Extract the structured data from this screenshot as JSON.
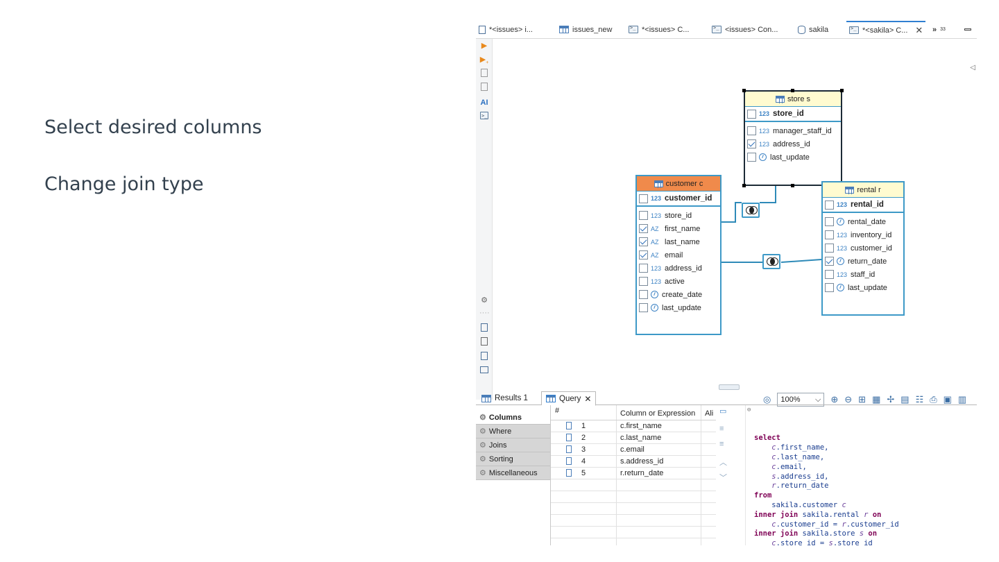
{
  "slide": {
    "bullets": [
      "Select desired columns",
      "Change join type"
    ]
  },
  "editor_tabs": [
    {
      "label": "*<issues> i...",
      "icon": "script-icon"
    },
    {
      "label": "issues_new",
      "icon": "table-icon"
    },
    {
      "label": "*<issues> C...",
      "icon": "sql-console-icon"
    },
    {
      "label": "<issues> Con...",
      "icon": "sql-console-icon"
    },
    {
      "label": "sakila",
      "icon": "database-icon"
    },
    {
      "label": "*<sakila> C...",
      "icon": "sql-console-icon",
      "active": true
    }
  ],
  "overflow_tabs": {
    "label": "»",
    "count": "33"
  },
  "left_toolbar": {
    "ai_label": "AI"
  },
  "entities": {
    "store": {
      "title": "store s",
      "pk": {
        "type": "123",
        "name": "store_id"
      },
      "columns": [
        {
          "type": "123",
          "name": "manager_staff_id",
          "checked": false
        },
        {
          "type": "123",
          "name": "address_id",
          "checked": true
        },
        {
          "type": "clock",
          "name": "last_update",
          "checked": false
        }
      ]
    },
    "customer": {
      "title": "customer c",
      "pk": {
        "type": "123",
        "name": "customer_id"
      },
      "columns": [
        {
          "type": "123",
          "name": "store_id",
          "checked": false
        },
        {
          "type": "AZ",
          "name": "first_name",
          "checked": true
        },
        {
          "type": "AZ",
          "name": "last_name",
          "checked": true
        },
        {
          "type": "AZ",
          "name": "email",
          "checked": true
        },
        {
          "type": "123",
          "name": "address_id",
          "checked": false
        },
        {
          "type": "123",
          "name": "active",
          "checked": false
        },
        {
          "type": "clock",
          "name": "create_date",
          "checked": false
        },
        {
          "type": "clock",
          "name": "last_update",
          "checked": false
        }
      ]
    },
    "rental": {
      "title": "rental r",
      "pk": {
        "type": "123",
        "name": "rental_id"
      },
      "columns": [
        {
          "type": "clock",
          "name": "rental_date",
          "checked": false
        },
        {
          "type": "123",
          "name": "inventory_id",
          "checked": false
        },
        {
          "type": "123",
          "name": "customer_id",
          "checked": false
        },
        {
          "type": "clock",
          "name": "return_date",
          "checked": true
        },
        {
          "type": "123",
          "name": "staff_id",
          "checked": false
        },
        {
          "type": "clock",
          "name": "last_update",
          "checked": false
        }
      ]
    }
  },
  "canvas_toolbar": {
    "zoom": "100%"
  },
  "results_tabs": [
    {
      "label": "Results 1"
    },
    {
      "label": "Query",
      "active": true
    }
  ],
  "query_sections": [
    "Columns",
    "Where",
    "Joins",
    "Sorting",
    "Miscellaneous"
  ],
  "query_grid": {
    "headers": [
      "#",
      "Column or Expression",
      "Ali"
    ],
    "rows": [
      {
        "n": "1",
        "expr": "c.first_name"
      },
      {
        "n": "2",
        "expr": "c.last_name"
      },
      {
        "n": "3",
        "expr": "c.email"
      },
      {
        "n": "4",
        "expr": "s.address_id"
      },
      {
        "n": "5",
        "expr": "r.return_date"
      }
    ]
  },
  "sql_lines": [
    [
      {
        "c": "kw",
        "t": "select"
      }
    ],
    [
      {
        "c": "",
        "t": "    "
      },
      {
        "c": "al",
        "t": "c"
      },
      {
        "c": "tx",
        "t": ".first_name,"
      }
    ],
    [
      {
        "c": "",
        "t": "    "
      },
      {
        "c": "al",
        "t": "c"
      },
      {
        "c": "tx",
        "t": ".last_name,"
      }
    ],
    [
      {
        "c": "",
        "t": "    "
      },
      {
        "c": "al",
        "t": "c"
      },
      {
        "c": "tx",
        "t": ".email,"
      }
    ],
    [
      {
        "c": "",
        "t": "    "
      },
      {
        "c": "al",
        "t": "s"
      },
      {
        "c": "tx",
        "t": ".address_id,"
      }
    ],
    [
      {
        "c": "",
        "t": "    "
      },
      {
        "c": "al",
        "t": "r"
      },
      {
        "c": "tx",
        "t": ".return_date"
      }
    ],
    [
      {
        "c": "kw",
        "t": "from"
      }
    ],
    [
      {
        "c": "",
        "t": "    "
      },
      {
        "c": "tx",
        "t": "sakila.customer "
      },
      {
        "c": "al",
        "t": "c"
      }
    ],
    [
      {
        "c": "kw",
        "t": "inner join "
      },
      {
        "c": "tx",
        "t": "sakila.rental "
      },
      {
        "c": "al",
        "t": "r"
      },
      {
        "c": "kw",
        "t": " on"
      }
    ],
    [
      {
        "c": "",
        "t": "    "
      },
      {
        "c": "al",
        "t": "c"
      },
      {
        "c": "tx",
        "t": ".customer_id = "
      },
      {
        "c": "al",
        "t": "r"
      },
      {
        "c": "tx",
        "t": ".customer_id"
      }
    ],
    [
      {
        "c": "kw",
        "t": "inner join "
      },
      {
        "c": "tx",
        "t": "sakila.store "
      },
      {
        "c": "al",
        "t": "s"
      },
      {
        "c": "kw",
        "t": " on"
      }
    ],
    [
      {
        "c": "",
        "t": "    "
      },
      {
        "c": "al",
        "t": "c"
      },
      {
        "c": "tx",
        "t": ".store_id = "
      },
      {
        "c": "al",
        "t": "s"
      },
      {
        "c": "tx",
        "t": ".store_id"
      }
    ]
  ]
}
